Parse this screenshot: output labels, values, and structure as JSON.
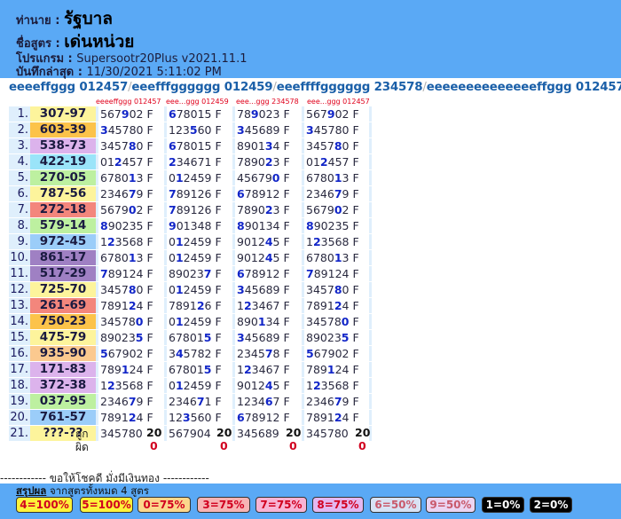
{
  "header": {
    "seller_label": "ท่านาย :",
    "seller": "รัฐบาล",
    "formula_label": "ชื่อสูตร :",
    "formula": "เด่นหน่วย",
    "program_label": "โปรแกรม :",
    "program": "Supersootr20Plus v2021.11.1",
    "saved_label": "บันทึกล่าสุด :",
    "saved": "11/30/2021 5:11:02 PM"
  },
  "formula_bar": {
    "f1": "eeeeffggg 012457",
    "f2": "eeefffgggggg 012459",
    "f3": "eeeffffgggggg 234578",
    "f4": "eeeeeeeeeeeeeeffggg 012457",
    "sep": "/"
  },
  "column_heads": [
    "eeeeffggg 012457",
    "eee...ggg 012459",
    "eee...ggg 234578",
    "eee...ggg 012457"
  ],
  "rows": [
    {
      "n": "1.",
      "r": "307-97",
      "c": "yellow",
      "f": [
        "567902 F",
        "678015 F",
        "789023 F",
        "567902 F"
      ],
      "h": [
        3,
        0,
        2,
        3
      ]
    },
    {
      "n": "2.",
      "r": "603-39",
      "c": "orange",
      "f": [
        "345780 F",
        "123560 F",
        "345689 F",
        "345780 F"
      ],
      "h": [
        0,
        3,
        0,
        0
      ]
    },
    {
      "n": "3.",
      "r": "538-73",
      "c": "lilac",
      "f": [
        "345780 F",
        "678015 F",
        "890134 F",
        "345780 F"
      ],
      "h": [
        4,
        0,
        4,
        4
      ]
    },
    {
      "n": "4.",
      "r": "422-19",
      "c": "cyan",
      "f": [
        "012457 F",
        "234671 F",
        "789023 F",
        "012457 F"
      ],
      "h": [
        2,
        0,
        4,
        2
      ]
    },
    {
      "n": "5.",
      "r": "270-05",
      "c": "green",
      "f": [
        "678013 F",
        "012459 F",
        "456790 F",
        "678013 F"
      ],
      "h": [
        4,
        1,
        5,
        4
      ]
    },
    {
      "n": "6.",
      "r": "787-56",
      "c": "yellow",
      "f": [
        "234679 F",
        "789126 F",
        "678912 F",
        "234679 F"
      ],
      "h": [
        4,
        0,
        0,
        4
      ]
    },
    {
      "n": "7.",
      "r": "272-18",
      "c": "red",
      "f": [
        "567902 F",
        "789126 F",
        "789023 F",
        "567902 F"
      ],
      "h": [
        4,
        0,
        4,
        4
      ]
    },
    {
      "n": "8.",
      "r": "579-14",
      "c": "green",
      "f": [
        "890235 F",
        "901348 F",
        "890134 F",
        "890235 F"
      ],
      "h": [
        0,
        0,
        0,
        0
      ]
    },
    {
      "n": "9.",
      "r": "972-45",
      "c": "blue",
      "f": [
        "123568 F",
        "012459 F",
        "901245 F",
        "123568 F"
      ],
      "h": [
        1,
        1,
        4,
        1
      ]
    },
    {
      "n": "10.",
      "r": "861-17",
      "c": "purple",
      "f": [
        "678013 F",
        "012459 F",
        "901245 F",
        "678013 F"
      ],
      "h": [
        4,
        1,
        4,
        4
      ]
    },
    {
      "n": "11.",
      "r": "517-29",
      "c": "purple",
      "f": [
        "789124 F",
        "890237 F",
        "678912 F",
        "789124 F"
      ],
      "h": [
        0,
        5,
        0,
        0
      ]
    },
    {
      "n": "12.",
      "r": "725-70",
      "c": "yellow",
      "f": [
        "345780 F",
        "012459 F",
        "345689 F",
        "345780 F"
      ],
      "h": [
        4,
        1,
        0,
        4
      ]
    },
    {
      "n": "13.",
      "r": "261-69",
      "c": "red",
      "f": [
        "789124 F",
        "789126 F",
        "123467 F",
        "789124 F"
      ],
      "h": [
        4,
        4,
        1,
        4
      ]
    },
    {
      "n": "14.",
      "r": "750-23",
      "c": "orange",
      "f": [
        "345780 F",
        "012459 F",
        "890134 F",
        "345780 F"
      ],
      "h": [
        5,
        1,
        3,
        5
      ]
    },
    {
      "n": "15.",
      "r": "475-79",
      "c": "yellow",
      "f": [
        "890235 F",
        "678015 F",
        "345689 F",
        "890235 F"
      ],
      "h": [
        5,
        5,
        0,
        5
      ]
    },
    {
      "n": "16.",
      "r": "935-90",
      "c": "tan",
      "f": [
        "567902 F",
        "345782 F",
        "234578 F",
        "567902 F"
      ],
      "h": [
        0,
        1,
        4,
        0
      ]
    },
    {
      "n": "17.",
      "r": "171-83",
      "c": "lilac",
      "f": [
        "789124 F",
        "678015 F",
        "123467 F",
        "789124 F"
      ],
      "h": [
        3,
        5,
        1,
        3
      ]
    },
    {
      "n": "18.",
      "r": "372-38",
      "c": "lilac",
      "f": [
        "123568 F",
        "012459 F",
        "901245 F",
        "123568 F"
      ],
      "h": [
        1,
        1,
        4,
        1
      ]
    },
    {
      "n": "19.",
      "r": "037-95",
      "c": "green",
      "f": [
        "234679 F",
        "234671 F",
        "123467 F",
        "234679 F"
      ],
      "h": [
        4,
        4,
        4,
        4
      ]
    },
    {
      "n": "20.",
      "r": "761-57",
      "c": "blue",
      "f": [
        "789124 F",
        "123560 F",
        "678912 F",
        "789124 F"
      ],
      "h": [
        4,
        2,
        0,
        4
      ]
    },
    {
      "n": "21.",
      "r": "???-??",
      "c": "yellow",
      "f": [
        "345780",
        "567904",
        "345689",
        "345780"
      ],
      "h": [
        -1,
        -1,
        -1,
        -1
      ]
    }
  ],
  "stats": {
    "hit_label": "ถูก",
    "miss_label": "ผิด",
    "hits": [
      "20",
      "20",
      "20",
      "20"
    ],
    "misses": [
      "0",
      "0",
      "0",
      "0"
    ]
  },
  "blessing": "------------ ขอให้โชคดี มั่งมีเงินทอง ------------",
  "summary": {
    "label": "สรุปผล",
    "text": "จากสูตรทั้งหมด 4 สูตร"
  },
  "badges": [
    {
      "label": "4=100%",
      "bg": "#fdf23a",
      "fg": "#d1001f"
    },
    {
      "label": "5=100%",
      "bg": "#fdf23a",
      "fg": "#d1001f"
    },
    {
      "label": "0=75%",
      "bg": "#fbd78c",
      "fg": "#d1001f"
    },
    {
      "label": "3=75%",
      "bg": "#f7b4b4",
      "fg": "#d1001f"
    },
    {
      "label": "7=75%",
      "bg": "#f8b4d4",
      "fg": "#d1001f"
    },
    {
      "label": "8=75%",
      "bg": "#e4b8f0",
      "fg": "#d1001f"
    },
    {
      "label": "6=50%",
      "bg": "#d8e2f4",
      "fg": "#c95a6c"
    },
    {
      "label": "9=50%",
      "bg": "#ebd5f2",
      "fg": "#c95a6c"
    },
    {
      "label": "1=0%",
      "bg": "#000000",
      "fg": "#ffffff"
    },
    {
      "label": "2=0%",
      "bg": "#000000",
      "fg": "#ffffff"
    }
  ]
}
